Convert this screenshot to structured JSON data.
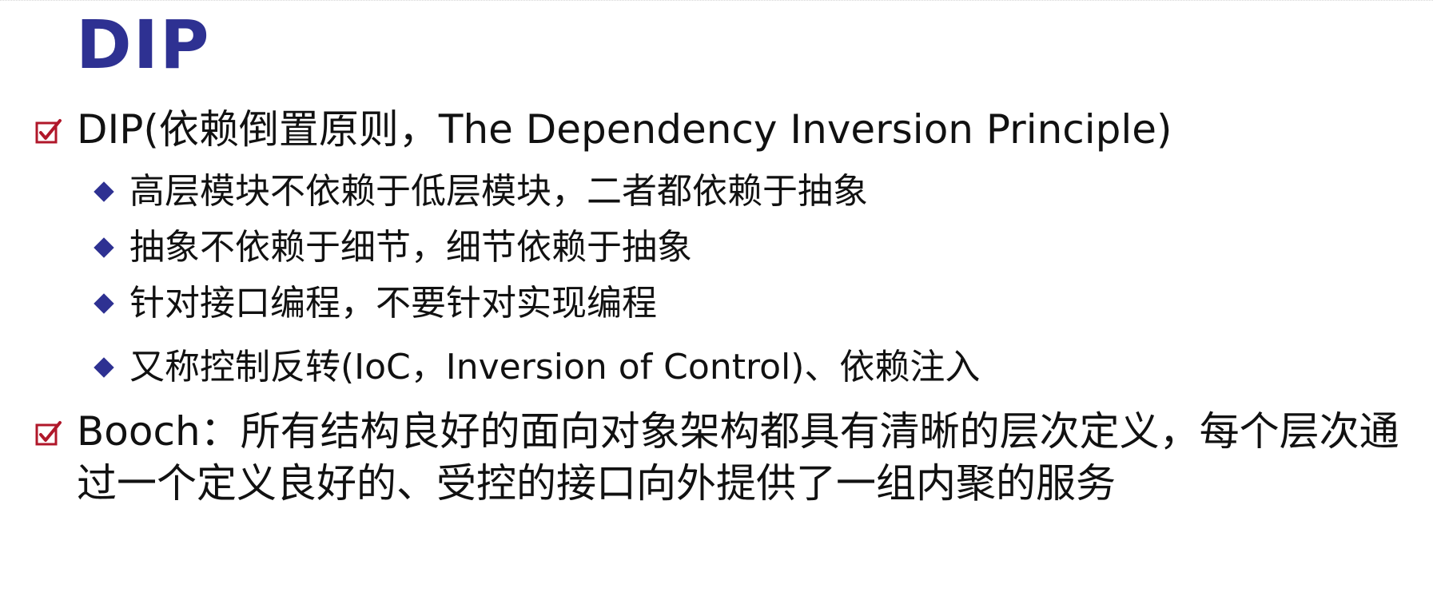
{
  "slide": {
    "title": "DIP",
    "bullets": [
      {
        "text": "DIP(依赖倒置原则，The Dependency Inversion Principle)",
        "sub_bullets": [
          "高层模块不依赖于低层模块，二者都依赖于抽象",
          "抽象不依赖于细节，细节依赖于抽象",
          "针对接口编程，不要针对实现编程",
          "又称控制反转(IoC，Inversion of Control)、依赖注入"
        ]
      },
      {
        "text": "Booch：所有结构良好的面向对象架构都具有清晰的层次定义，每个层次通过一个定义良好的、受控的接口向外提供了一组内聚的服务"
      }
    ]
  },
  "colors": {
    "title": "#2e3192",
    "checkbox": "#b0172a",
    "diamond": "#2e3192",
    "text": "#111111"
  },
  "icons": {
    "level1_bullet": "checkbox-icon",
    "level2_bullet": "diamond-icon"
  }
}
